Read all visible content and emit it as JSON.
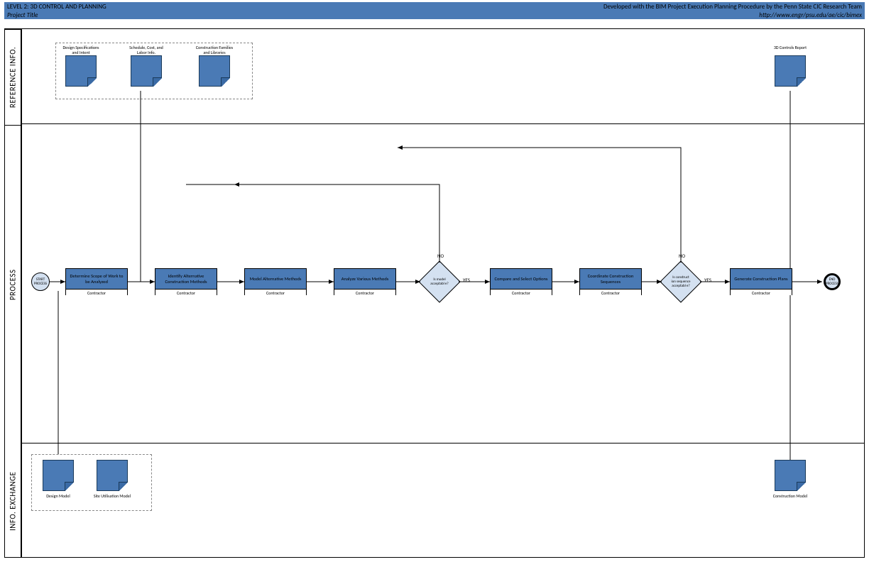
{
  "header": {
    "title": "LEVEL 2: 3D CONTROL AND PLANNING",
    "subtitle": "Project Title",
    "dev_line": "Developed with the BIM Project Execution Planning Procedure by the Penn State CIC Research Team",
    "url": "http://www.engr/psu.edu/ae/cic/bimex"
  },
  "lanes": {
    "reference": "REFERENCE INFO.",
    "process": "PROCESS",
    "info_exchange": "INFO. EXCHANGE"
  },
  "ref_docs": [
    {
      "label": "Design Specifications and Intent"
    },
    {
      "label": "Schedule, Cost, and Labor Info."
    },
    {
      "label": "Construction Families and Libraries"
    }
  ],
  "ref_output": {
    "label": "3D Controls Report"
  },
  "process": {
    "start": "START PROCESS",
    "end": "END PROCESS",
    "steps": [
      {
        "title": "Determine Scope of Work to be Analyzed",
        "role": "Contractor"
      },
      {
        "title": "Identify Alternative Construction Methods",
        "role": "Contractor"
      },
      {
        "title": "Model Alternative Methods",
        "role": "Contractor"
      },
      {
        "title": "Analyze Various Methods",
        "role": "Contractor"
      },
      {
        "title": "Compare and Select Options",
        "role": "Contractor"
      },
      {
        "title": "Coordinate Construction Sequences",
        "role": "Contractor"
      },
      {
        "title": "Generate Construction Plans",
        "role": "Contractor"
      }
    ],
    "gateways": [
      {
        "label": "Is model acceptabl e?",
        "yes": "YES",
        "no": "NO"
      },
      {
        "label": "Is construct ion sequence acceptabl e?",
        "yes": "YES",
        "no": "NO"
      }
    ],
    "yes": "YES",
    "no": "NO"
  },
  "info_docs": [
    {
      "label": "Design Model"
    },
    {
      "label": "Site Utilisation Model"
    }
  ],
  "info_output": {
    "label": "Construction Model"
  },
  "chart_data": {
    "type": "flowchart",
    "title": "LEVEL 2: 3D CONTROL AND PLANNING",
    "swimlanes": [
      "REFERENCE INFO.",
      "PROCESS",
      "INFO. EXCHANGE"
    ],
    "nodes": [
      {
        "id": "ref1",
        "lane": "REFERENCE INFO.",
        "type": "document",
        "label": "Design Specifications and Intent"
      },
      {
        "id": "ref2",
        "lane": "REFERENCE INFO.",
        "type": "document",
        "label": "Schedule, Cost, and Labor Info."
      },
      {
        "id": "ref3",
        "lane": "REFERENCE INFO.",
        "type": "document",
        "label": "Construction Families and Libraries"
      },
      {
        "id": "refout",
        "lane": "REFERENCE INFO.",
        "type": "document",
        "label": "3D Controls Report"
      },
      {
        "id": "start",
        "lane": "PROCESS",
        "type": "start",
        "label": "START PROCESS"
      },
      {
        "id": "p1",
        "lane": "PROCESS",
        "type": "task",
        "label": "Determine Scope of Work to be Analyzed",
        "role": "Contractor"
      },
      {
        "id": "p2",
        "lane": "PROCESS",
        "type": "task",
        "label": "Identify Alternative Construction Methods",
        "role": "Contractor"
      },
      {
        "id": "p3",
        "lane": "PROCESS",
        "type": "task",
        "label": "Model Alternative Methods",
        "role": "Contractor"
      },
      {
        "id": "p4",
        "lane": "PROCESS",
        "type": "task",
        "label": "Analyze Various Methods",
        "role": "Contractor"
      },
      {
        "id": "g1",
        "lane": "PROCESS",
        "type": "gateway",
        "label": "Is model acceptable?"
      },
      {
        "id": "p5",
        "lane": "PROCESS",
        "type": "task",
        "label": "Compare and Select Options",
        "role": "Contractor"
      },
      {
        "id": "p6",
        "lane": "PROCESS",
        "type": "task",
        "label": "Coordinate Construction Sequences",
        "role": "Contractor"
      },
      {
        "id": "g2",
        "lane": "PROCESS",
        "type": "gateway",
        "label": "Is construction sequence acceptable?"
      },
      {
        "id": "p7",
        "lane": "PROCESS",
        "type": "task",
        "label": "Generate Construction Plans",
        "role": "Contractor"
      },
      {
        "id": "end",
        "lane": "PROCESS",
        "type": "end",
        "label": "END PROCESS"
      },
      {
        "id": "ie1",
        "lane": "INFO. EXCHANGE",
        "type": "document",
        "label": "Design Model"
      },
      {
        "id": "ie2",
        "lane": "INFO. EXCHANGE",
        "type": "document",
        "label": "Site Utilisation Model"
      },
      {
        "id": "ieout",
        "lane": "INFO. EXCHANGE",
        "type": "document",
        "label": "Construction Model"
      }
    ],
    "edges": [
      {
        "from": "start",
        "to": "p1"
      },
      {
        "from": "p1",
        "to": "p2"
      },
      {
        "from": "p2",
        "to": "p3"
      },
      {
        "from": "p3",
        "to": "p4"
      },
      {
        "from": "p4",
        "to": "g1"
      },
      {
        "from": "g1",
        "to": "p5",
        "label": "YES"
      },
      {
        "from": "g1",
        "to": "p2",
        "label": "NO"
      },
      {
        "from": "p5",
        "to": "p6"
      },
      {
        "from": "p6",
        "to": "g2"
      },
      {
        "from": "g2",
        "to": "p7",
        "label": "YES"
      },
      {
        "from": "g2",
        "to": "p4",
        "label": "NO"
      },
      {
        "from": "p7",
        "to": "end"
      },
      {
        "from": "ref2",
        "to": "p1"
      },
      {
        "from": "ie1",
        "to": "p1"
      },
      {
        "from": "ie2",
        "to": "p1"
      },
      {
        "from": "p7",
        "to": "refout"
      },
      {
        "from": "p7",
        "to": "ieout"
      }
    ]
  }
}
